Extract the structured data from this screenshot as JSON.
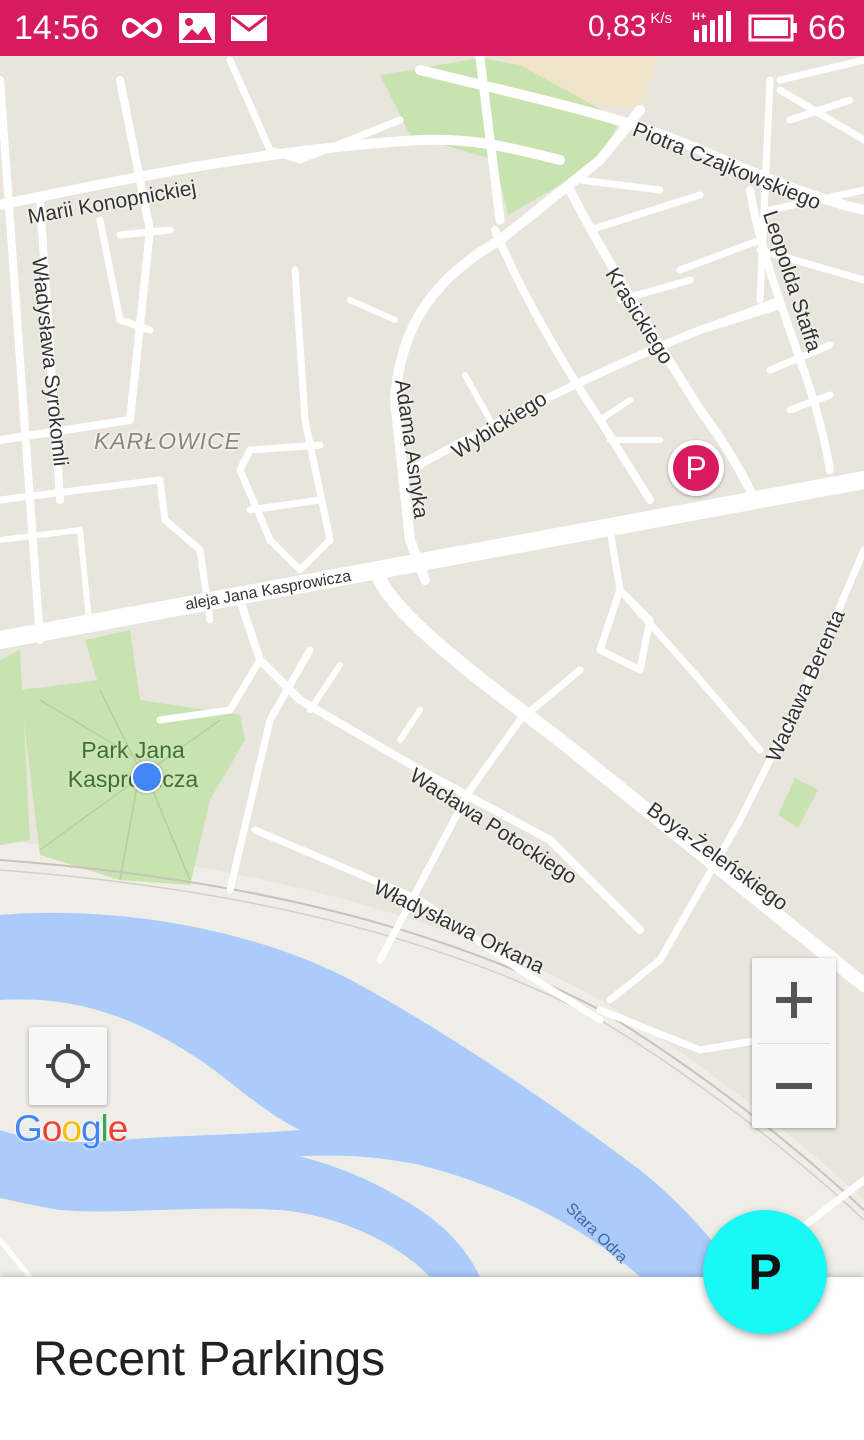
{
  "status_bar": {
    "time": "14:56",
    "speed": "0,83",
    "speed_unit": "K/s",
    "battery": "66",
    "icons": [
      "infinity-icon",
      "image-icon",
      "mail-icon",
      "signal-icon",
      "battery-icon"
    ]
  },
  "map": {
    "streets": {
      "konopnickiej": "Marii Konopnickiej",
      "czajkowskiego": "Piotra Czajkowskiego",
      "syrokomli": "Władysława Syrokomli",
      "krasickiego": "Krasickiego",
      "staffa": "Leopolda Staffa",
      "asnyka": "Adama Asnyka",
      "wybickiego": "Wybickiego",
      "kasprowicza": "aleja Jana Kasprowicza",
      "berenta": "Wacława Berenta",
      "potockiego": "Wacława Potockiego",
      "zelenskiego": "Boya-Żeleńskiego",
      "orkana": "Władysława Orkana"
    },
    "district": "KARŁOWICE",
    "park": "Park Jana Kasprowicza",
    "river": "Stara Odra",
    "parking_marker_label": "P",
    "colors": {
      "land": "#e8e5dd",
      "road": "#ffffff",
      "park": "#c9e3b0",
      "water": "#aacbfb",
      "marker": "#d81b5e"
    }
  },
  "controls": {
    "zoom_in": "+",
    "zoom_out": "−",
    "google_logo": [
      "G",
      "o",
      "o",
      "g",
      "l",
      "e"
    ],
    "google_colors": [
      "#4285f4",
      "#ea4335",
      "#fbbc05",
      "#4285f4",
      "#34a853",
      "#ea4335"
    ]
  },
  "sheet": {
    "title": "Recent Parkings"
  },
  "fab": {
    "label": "P",
    "color": "#18f8f4"
  }
}
